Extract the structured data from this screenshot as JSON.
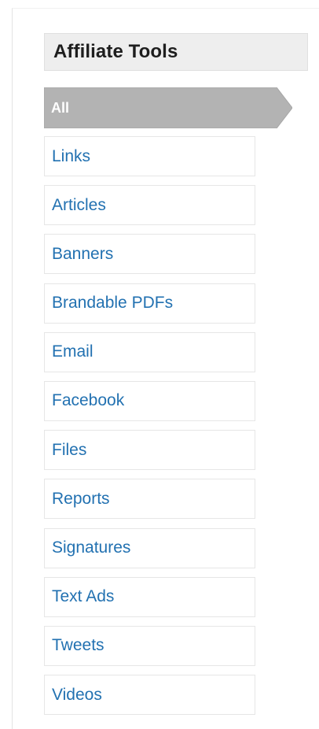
{
  "panel": {
    "title": "Affiliate Tools"
  },
  "active_tab": {
    "label": "All",
    "color": "#b3b3b3",
    "border_color": "#a6a6a6"
  },
  "tools": [
    {
      "label": "Links"
    },
    {
      "label": "Articles"
    },
    {
      "label": "Banners"
    },
    {
      "label": "Brandable PDFs"
    },
    {
      "label": "Email"
    },
    {
      "label": "Facebook"
    },
    {
      "label": "Files"
    },
    {
      "label": "Reports"
    },
    {
      "label": "Signatures"
    },
    {
      "label": "Text Ads"
    },
    {
      "label": "Tweets"
    },
    {
      "label": "Videos"
    }
  ],
  "colors": {
    "link": "#2271b1",
    "header_bg": "#eeeeee"
  }
}
